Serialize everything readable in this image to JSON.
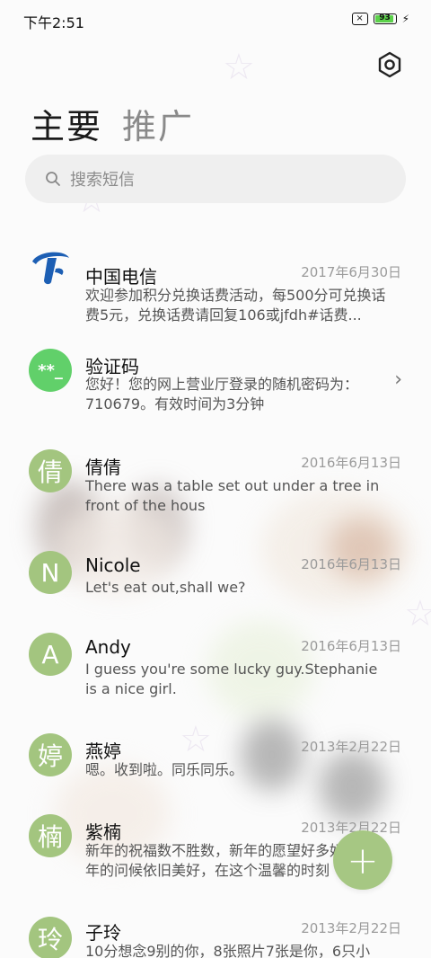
{
  "status": {
    "time": "下午2:51",
    "battery": "93"
  },
  "tabs": {
    "primary": "主要",
    "promo": "推广"
  },
  "search": {
    "placeholder": "搜索短信"
  },
  "conversations": [
    {
      "name": "中国电信",
      "date": "2017年6月30日",
      "preview": "欢迎参加积分兑换话费活动，每500分可兑换话费5元，兑换话费请回复106或jfdh#话费..."
    },
    {
      "name": "验证码",
      "avatar": "**_",
      "preview": "您好！您的网上营业厅登录的随机密码为：710679。有效时间为3分钟"
    },
    {
      "name": "倩倩",
      "avatar": "倩",
      "date": "2016年6月13日",
      "preview": "There was a table set out under a tree in front of the hous"
    },
    {
      "name": "Nicole",
      "avatar": "N",
      "date": "2016年6月13日",
      "preview": "Let's eat out,shall we?"
    },
    {
      "name": "Andy",
      "avatar": "A",
      "date": "2016年6月13日",
      "preview": "I guess you're some lucky guy.Stephanie is a nice girl."
    },
    {
      "name": "燕婷",
      "avatar": "婷",
      "date": "2013年2月22日",
      "preview": "嗯。收到啦。同乐同乐。"
    },
    {
      "name": "紫楠",
      "avatar": "楠",
      "date": "2013年2月22日",
      "preview": "新年的祝福数不胜数，新年的愿望好多好多，新年的问候依旧美好，在这个温馨的时刻"
    },
    {
      "name": "子玲",
      "avatar": "玲",
      "date": "2013年2月22日",
      "preview": "10分想念9别的你，8张照片7张是你，6只小"
    }
  ],
  "fab": {
    "label": "+"
  },
  "colors": {
    "accent": "#a6c783",
    "code_avatar": "#61d06a",
    "telecom_blue": "#1d5fb4"
  },
  "icons": {
    "settings": "gear-icon",
    "search": "search-icon",
    "new_message": "plus-icon"
  }
}
